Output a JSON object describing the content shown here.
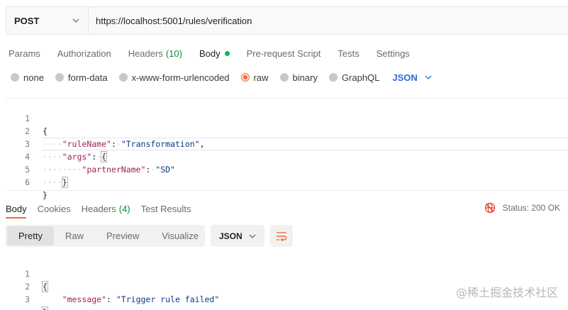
{
  "request": {
    "method": "POST",
    "url": "https://localhost:5001/rules/verification"
  },
  "request_tabs": [
    {
      "label": "Params"
    },
    {
      "label": "Authorization"
    },
    {
      "label": "Headers",
      "count": "(10)"
    },
    {
      "label": "Body",
      "active": true
    },
    {
      "label": "Pre-request Script"
    },
    {
      "label": "Tests"
    },
    {
      "label": "Settings"
    }
  ],
  "body_types": [
    {
      "label": "none"
    },
    {
      "label": "form-data"
    },
    {
      "label": "x-www-form-urlencoded"
    },
    {
      "label": "raw",
      "selected": true
    },
    {
      "label": "binary"
    },
    {
      "label": "GraphQL"
    }
  ],
  "body_language": "JSON",
  "request_body": {
    "line_numbers": [
      "1",
      "2",
      "3",
      "4",
      "5",
      "6"
    ],
    "rule_key": "\"ruleName\"",
    "rule_value": "\"Transformation\"",
    "args_key": "\"args\"",
    "partner_key": "\"partnerName\"",
    "partner_value": "\"SD\""
  },
  "response_tabs": [
    {
      "label": "Body",
      "active": true
    },
    {
      "label": "Cookies"
    },
    {
      "label": "Headers",
      "count": "(4)"
    },
    {
      "label": "Test Results"
    }
  ],
  "status_text": "Status: 200 OK",
  "view_modes": [
    "Pretty",
    "Raw",
    "Preview",
    "Visualize"
  ],
  "response_format": "JSON",
  "response_body": {
    "line_numbers": [
      "1",
      "2",
      "3"
    ],
    "message_key": "\"message\"",
    "message_value": "\"Trigger rule failed\""
  },
  "watermark": "@稀土掘金技术社区",
  "colors": {
    "accent": "#f26b3a",
    "active_dot": "#0cbb52",
    "link": "#2b6cd8"
  }
}
